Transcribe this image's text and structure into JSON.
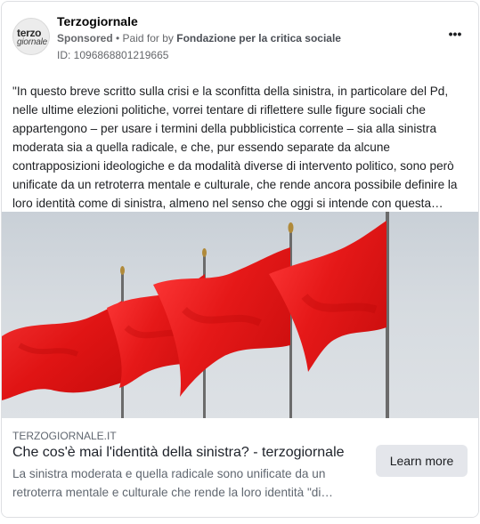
{
  "post": {
    "page_name": "Terzogiornale",
    "sponsored_label": "Sponsored",
    "separator": " • ",
    "paid_for_prefix": "Paid for by ",
    "payer": "Fondazione per la critica sociale",
    "ad_id": "ID: 1096868801219665",
    "more_icon": "more-options-icon",
    "more_glyph": "•••",
    "avatar_line1": "terzo",
    "avatar_line2": "giornale",
    "body": "\"In questo breve scritto sulla crisi e la sconfitta della sinistra, in particolare del Pd, nelle ultime elezioni politiche, vorrei tentare di riflettere sulle figure sociali che appartengono – per usare i termini della pubblicistica corrente – sia alla sinistra moderata sia a quella radicale, e che, pur essendo separate da alcune contrapposizioni ideologiche e da modalità diverse di intervento politico, sono però unificate da un retroterra mentale e culturale, che rende ancora possibile definire la loro identità come di sinistra, almeno nel senso che oggi si intende con questa…"
  },
  "link": {
    "domain": "terzogiornale.it",
    "title": "Che cos'è mai l'identità della sinistra? - terzogiornale",
    "description": "La sinistra moderata e quella radicale sono unificate da un retroterra mentale e culturale che rende la loro identità \"di…",
    "cta_label": "Learn more"
  },
  "colors": {
    "flag_red": "#ee1c1c",
    "sky": "#d6dbe0",
    "cta_bg": "#e4e6eb"
  }
}
